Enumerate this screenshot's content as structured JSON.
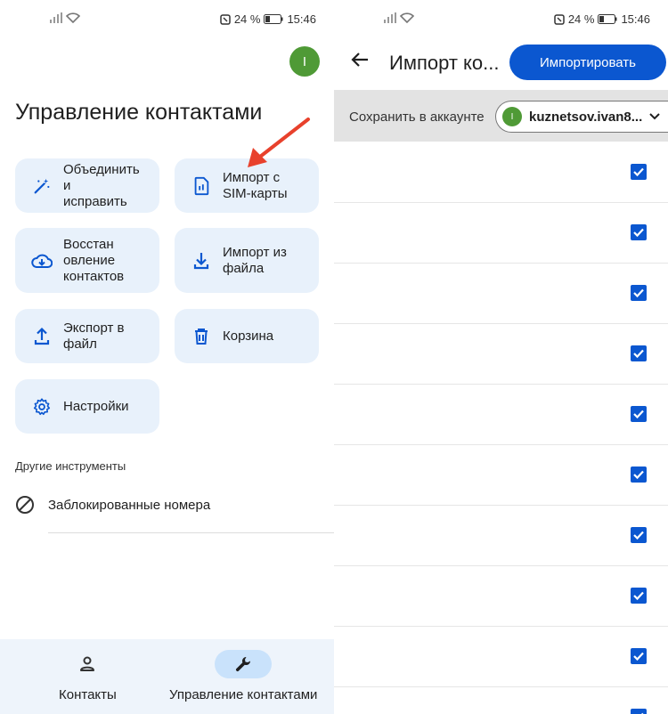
{
  "status": {
    "battery": "24 %",
    "time": "15:46"
  },
  "left": {
    "avatar_letter": "I",
    "title": "Управление контактами",
    "tiles": [
      {
        "label": "Объединить и исправить",
        "icon": "magic-wand-icon"
      },
      {
        "label": "Импорт с SIM-карты",
        "icon": "sim-card-icon"
      },
      {
        "label": "Восстан овление контактов",
        "icon": "cloud-download-icon"
      },
      {
        "label": "Импорт из файла",
        "icon": "download-icon"
      },
      {
        "label": "Экспорт в файл",
        "icon": "upload-icon"
      },
      {
        "label": "Корзина",
        "icon": "trash-icon"
      },
      {
        "label": "Настройки",
        "icon": "settings-icon"
      }
    ],
    "other_tools_label": "Другие инструменты",
    "blocked_label": "Заблокированные номера",
    "nav": {
      "contacts": "Контакты",
      "manage": "Управление контактами"
    }
  },
  "right": {
    "title": "Импорт ко...",
    "import_button": "Импортировать",
    "save_label": "Сохранить в аккаунте",
    "account_letter": "I",
    "account_email": "kuznetsov.ivan8...",
    "contacts": [
      {
        "name": "",
        "checked": true
      },
      {
        "name": "",
        "checked": true
      },
      {
        "name": "",
        "checked": true
      },
      {
        "name": "",
        "checked": true
      },
      {
        "name": "",
        "checked": true
      },
      {
        "name": "",
        "checked": true
      },
      {
        "name": "",
        "checked": true
      },
      {
        "name": "",
        "checked": true
      },
      {
        "name": "",
        "checked": true
      },
      {
        "name": "",
        "checked": true
      }
    ]
  },
  "colors": {
    "accent": "#0b57d0",
    "tile_bg": "#e8f1fb",
    "avatar": "#4f9a36",
    "arrow": "#e8412c"
  }
}
